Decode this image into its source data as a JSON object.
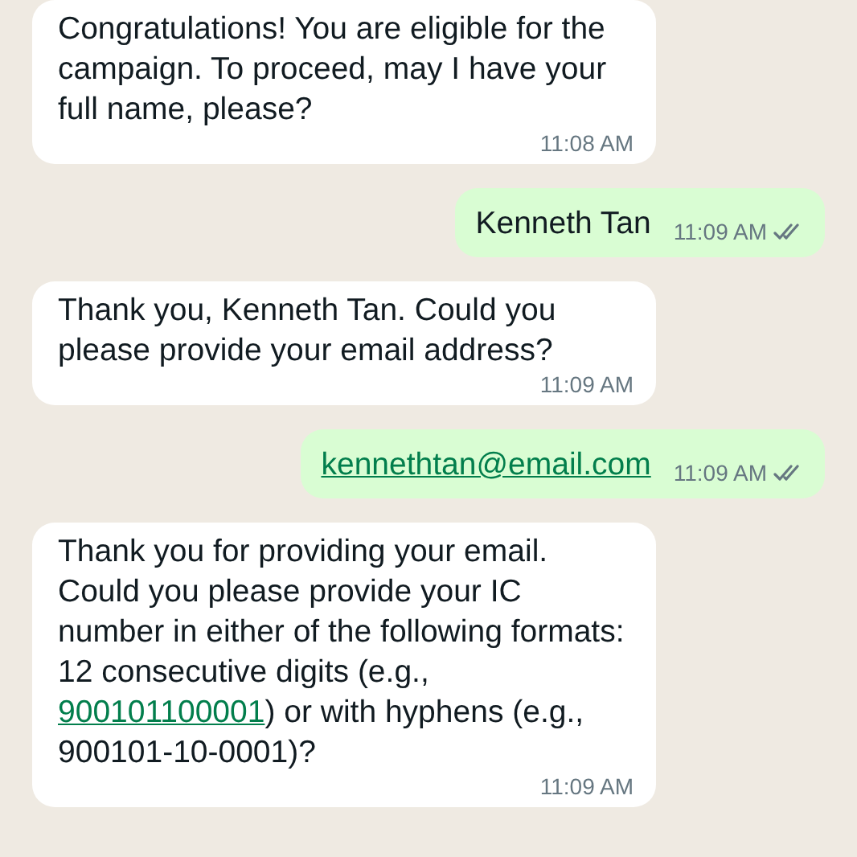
{
  "messages": [
    {
      "kind": "incoming",
      "parts": [
        {
          "kind": "text",
          "text": "Congratulations! You are eligible for the campaign. To proceed, may I have your full name, please?"
        }
      ],
      "time": "11:08 AM"
    },
    {
      "kind": "outgoing",
      "parts": [
        {
          "kind": "text",
          "text": "Kenneth Tan"
        }
      ],
      "time": "11:09 AM",
      "read": false
    },
    {
      "kind": "incoming",
      "parts": [
        {
          "kind": "text",
          "text": "Thank you, Kenneth Tan. Could you please provide your email address?"
        }
      ],
      "time": "11:09 AM"
    },
    {
      "kind": "outgoing",
      "parts": [
        {
          "kind": "link",
          "text": "kennethtan@email.com"
        }
      ],
      "time": "11:09 AM",
      "read": false
    },
    {
      "kind": "incoming",
      "parts": [
        {
          "kind": "text",
          "text": "Thank you for providing your email. Could you please provide your IC number in either of the following formats: 12 consecutive digits (e.g., "
        },
        {
          "kind": "link",
          "text": "900101100001"
        },
        {
          "kind": "text",
          "text": ") or with hyphens (e.g., 900101-10-0001)?"
        }
      ],
      "time": "11:09 AM"
    }
  ]
}
